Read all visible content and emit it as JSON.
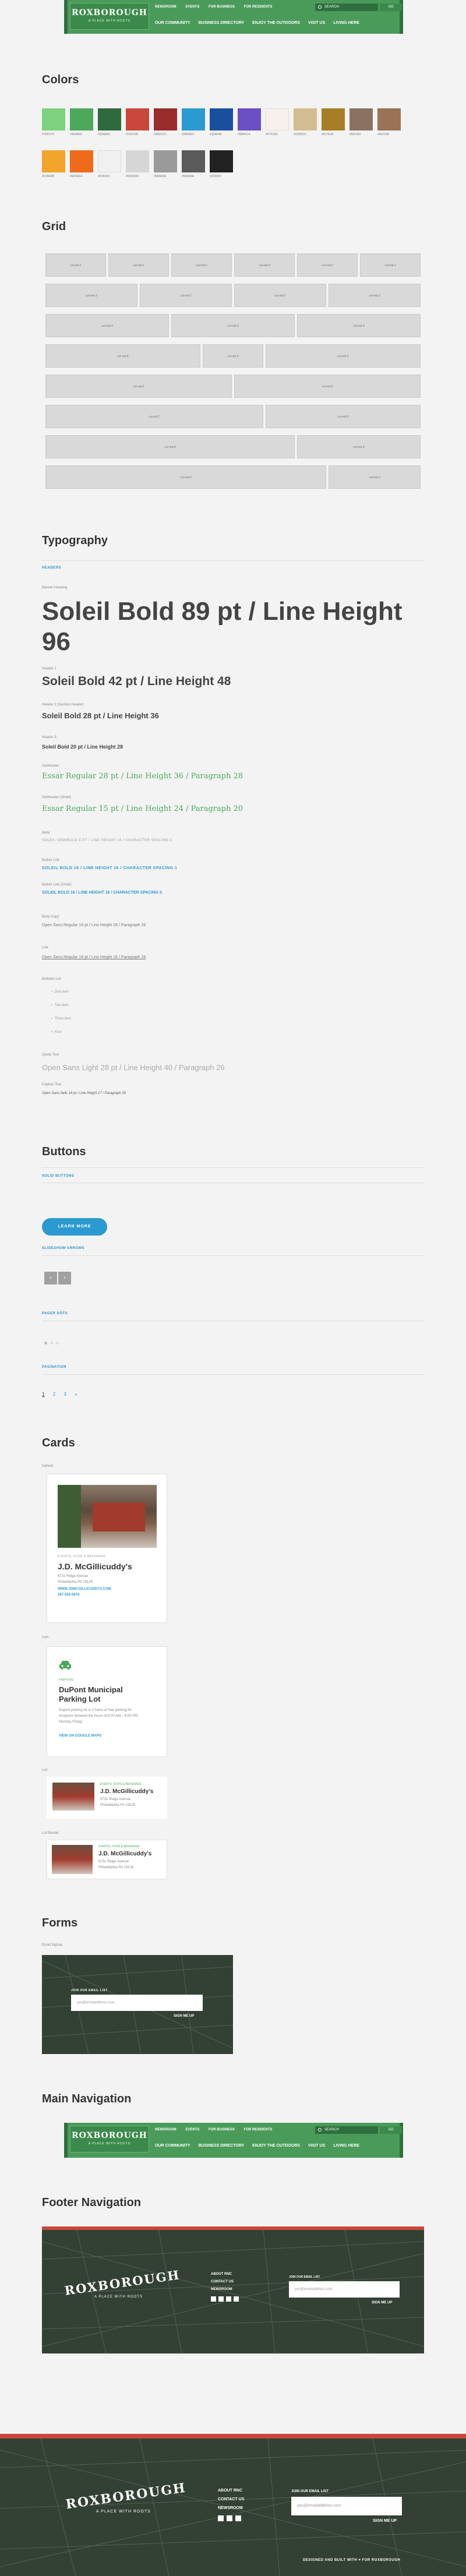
{
  "nav": {
    "logo_name": "ROXBOROUGH",
    "logo_tag": "A PLACE WITH ROOTS",
    "top_links": [
      "NEWSROOM",
      "EVENTS",
      "FOR BUSINESS",
      "FOR RESIDENTS"
    ],
    "search_placeholder": "SEARCH",
    "go_label": "GO",
    "main_links": [
      "OUR COMMUNITY",
      "BUSINESS DIRECTORY",
      "ENJOY THE OUTDOORS",
      "VISIT US",
      "LIVING HERE"
    ]
  },
  "colors": {
    "title": "Colors",
    "swatches": [
      {
        "hex": "#7dd17f",
        "name": "#7DD17F"
      },
      {
        "hex": "#4ea85c",
        "name": "#4EA85C"
      },
      {
        "hex": "#2d6b3c",
        "name": "#2D6B3C"
      },
      {
        "hex": "#c9473b",
        "name": "#C9473B"
      },
      {
        "hex": "#9b2c2c",
        "name": "#9B2C2C"
      },
      {
        "hex": "#2b9ad1",
        "name": "#2B9AD1"
      },
      {
        "hex": "#1a4fa0",
        "name": "#1A4FA0"
      },
      {
        "hex": "#6b4fc4",
        "name": "#6B4FC4"
      },
      {
        "hex": "#f7f1ec",
        "name": "#F7F1EC"
      },
      {
        "hex": "#d2bd91",
        "name": "#D2BD91"
      },
      {
        "hex": "#a77e25",
        "name": "#A77E25"
      },
      {
        "hex": "#8a7261",
        "name": "#8A7261"
      },
      {
        "hex": "#9a7255",
        "name": "#9A7255"
      },
      {
        "hex": "#f2a42b",
        "name": "#F2A42B"
      },
      {
        "hex": "#ef6a1a",
        "name": "#EF6A1A"
      },
      {
        "hex": "#f0f0f0",
        "name": "#F0F0F0"
      },
      {
        "hex": "#d6d6d6",
        "name": "#D6D6D6"
      },
      {
        "hex": "#9a9a9a",
        "name": "#9A9A9A"
      },
      {
        "hex": "#5a5a5a",
        "name": "#5A5A5A"
      },
      {
        "hex": "#222222",
        "name": "#222222"
      }
    ]
  },
  "grid": {
    "title": "Grid",
    "rows": [
      [
        "col-md-2",
        "col-md-2",
        "col-md-2",
        "col-md-2",
        "col-md-2",
        "col-md-2"
      ],
      [
        "col-md-3",
        "col-md-3",
        "col-md-3",
        "col-md-3"
      ],
      [
        "col-md-4",
        "col-md-4",
        "col-md-4"
      ],
      [
        "col-md-5",
        "col-md-2",
        "col-md-5"
      ],
      [
        "col-md-6",
        "col-md-6"
      ],
      [
        "col-md-7",
        "col-md-5"
      ],
      [
        "col-md-8",
        "col-md-4"
      ],
      [
        "col-md-9",
        "col-md-3"
      ]
    ]
  },
  "typography": {
    "title": "Typography",
    "headers_label": "HEADERS",
    "items": [
      {
        "label": "Banner Heading",
        "text": "Soleil Bold 89 pt / Line Height 96"
      },
      {
        "label": "Header 1",
        "text": "Soleil Bold 42 pt / Line Height 48"
      },
      {
        "label": "Header 2 (Section Header)",
        "text": "Soleil Bold 28 pt / Line Height 36"
      },
      {
        "label": "Header 3",
        "text": "Soleil Bold 20 pt / Line Height 28"
      },
      {
        "label": "Subheader",
        "text": "Essar Regular 28 pt / Line Height 36 / Paragraph 28"
      },
      {
        "label": "Subheader (Small)",
        "text": "Essar Regular 15 pt / Line Height 24 / Paragraph 20"
      },
      {
        "label": "Meta",
        "text": "SOLEIL SEMIBOLD 8 PT / LINE HEIGHT 16 / CHARACTER SPACING 1"
      },
      {
        "label": "Button Link",
        "text": "SOLEIL BOLD 16 / LINE HEIGHT 16 / CHARACTER SPACING 1"
      },
      {
        "label": "Button Link (Small)",
        "text": "SOLEIL BOLD 16 / LINE HEIGHT 16 / CHARACTER SPACING 0"
      },
      {
        "label": "Body Copy",
        "text": "Open Sans Regular 16 pt / Line Height 26 / Paragraph 26"
      },
      {
        "label": "Link",
        "text": "Open Sans Regular 16 pt / Line Height 26 / Paragraph 26"
      }
    ],
    "bulleted_label": "Bulleted List",
    "bullets": [
      "One item",
      "Two item",
      "Three item",
      "Four"
    ],
    "quote_label": "Quote Text",
    "quote_text": "Open Sans Light 28 pt / Line Height 40 / Paragraph 26",
    "caption_label": "Caption Text",
    "caption_text": "Open Sans Italic 14 pt / Line Height 17 / Paragraph 26"
  },
  "buttons": {
    "title": "Buttons",
    "solid_label": "SOLID BUTTONS",
    "learn_more": "LEARN MORE",
    "arrows_label": "SLIDESHOW ARROWS",
    "prev": "‹",
    "next": "›",
    "pager_label": "PAGER DOTS",
    "pagination_label": "PAGINATION",
    "pages": [
      "1",
      "2",
      "3",
      "»"
    ]
  },
  "cards": {
    "title": "Cards",
    "default_label": "Default",
    "card1": {
      "category": "EVENTS, FOOD & BEVERAGE",
      "title": "J.D. McGillicuddy's",
      "address1": "6731 Ridge Avenue",
      "address2": "Philadelphia PA 19128",
      "link": "WWW.JDMCGILLICUDDYS.COM",
      "phone": "267-555-5670"
    },
    "icon_label": "Icon",
    "card2": {
      "category": "PARKING",
      "title": "DuPont Municipal Parking Lot",
      "desc": "Dupont parking lot is 2 hours of free parking for shoppers between the hours of 8:00 AM – 6:00 PM Monday-Friday",
      "link": "VIEW ON GOOGLE MAPS"
    },
    "list_label": "List",
    "card3": {
      "category": "EVENTS, FOOD & BEVERAGE",
      "title": "J.D. McGillicuddy's",
      "address1": "6731 Ridge Avenue",
      "address2": "Philadelphia PA 19128"
    },
    "list_border_label": "List Border",
    "card4": {
      "category": "EVENTS, FOOD & BEVERAGE",
      "title": "J.D. McGillicuddy's",
      "address1": "6731 Ridge Avenue",
      "address2": "Philadelphia PA 19128"
    }
  },
  "forms": {
    "title": "Forms",
    "signup_label": "Email Signup",
    "join_label": "JOIN OUR EMAIL LIST",
    "email_placeholder": "you@emailaddress.com",
    "signup_button": "SIGN ME UP"
  },
  "main_nav": {
    "title": "Main Navigation"
  },
  "footer_nav": {
    "title": "Footer Navigation",
    "links": [
      "ABOUT RNC",
      "CONTACT US",
      "NEWSROOM"
    ],
    "join_label": "JOIN OUR EMAIL LIST",
    "email_placeholder": "you@emailaddress.com",
    "signup_button": "SIGN ME UP",
    "designed": "DESIGNED AND BUILT WITH ♥ FOR ROXBOROUGH"
  }
}
